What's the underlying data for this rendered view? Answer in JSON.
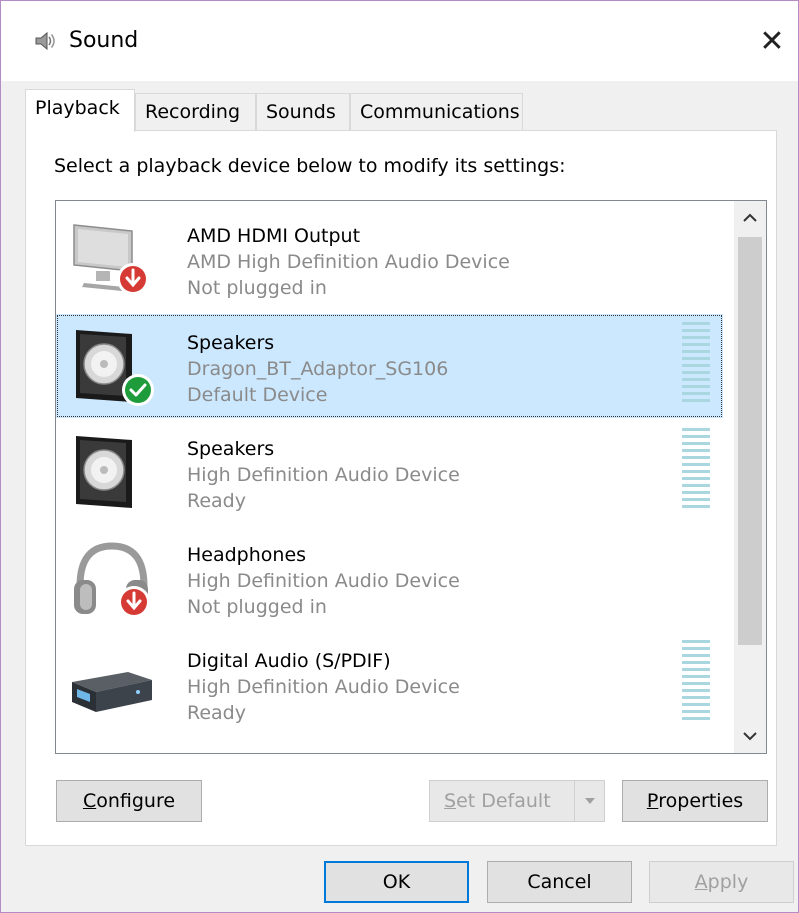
{
  "window": {
    "title": "Sound",
    "close_glyph": "✕"
  },
  "tabs": [
    {
      "label": "Playback",
      "active": true
    },
    {
      "label": "Recording",
      "active": false
    },
    {
      "label": "Sounds",
      "active": false
    },
    {
      "label": "Communications",
      "active": false
    }
  ],
  "instruction": "Select a playback device below to modify its settings:",
  "devices": [
    {
      "name": "AMD HDMI Output",
      "description": "AMD High Definition Audio Device",
      "status": "Not plugged in",
      "icon": "monitor-icon",
      "badge": "unplugged-badge-icon",
      "selected": false,
      "meter": false
    },
    {
      "name": "Speakers",
      "description": "Dragon_BT_Adaptor_SG106",
      "status": "Default Device",
      "icon": "speaker-icon",
      "badge": "default-check-icon",
      "selected": true,
      "meter": true
    },
    {
      "name": "Speakers",
      "description": "High Definition Audio Device",
      "status": "Ready",
      "icon": "speaker-icon",
      "badge": null,
      "selected": false,
      "meter": true
    },
    {
      "name": "Headphones",
      "description": "High Definition Audio Device",
      "status": "Not plugged in",
      "icon": "headphones-icon",
      "badge": "unplugged-badge-icon",
      "selected": false,
      "meter": false
    },
    {
      "name": "Digital Audio (S/PDIF)",
      "description": "High Definition Audio Device",
      "status": "Ready",
      "icon": "digital-audio-icon",
      "badge": null,
      "selected": false,
      "meter": true
    }
  ],
  "buttons": {
    "configure": {
      "first": "C",
      "rest": "onfigure"
    },
    "set_default": {
      "first": "S",
      "rest": "et Default"
    },
    "properties": {
      "first": "P",
      "rest": "roperties"
    },
    "ok": "OK",
    "cancel": "Cancel",
    "apply": {
      "first": "A",
      "rest": "pply"
    }
  },
  "colors": {
    "selection": "#cce8ff",
    "focus_border": "#0078d7",
    "badge_red": "#d63a34",
    "badge_green": "#1e9b3b",
    "meter": "#aad6e0"
  }
}
